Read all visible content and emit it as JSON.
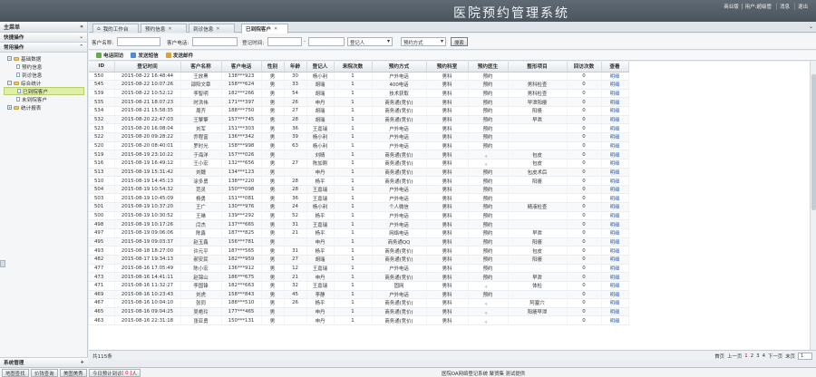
{
  "app": {
    "title": "医院预约管理系统",
    "top_links": [
      "商业版 | 用户名",
      "退出",
      "消息",
      "退出"
    ]
  },
  "topbar": {
    "links": [
      "商业版 │ 用户:超级管",
      "消息",
      "退出"
    ]
  },
  "left": {
    "main_menu": "主菜单",
    "quick_ops": "快捷操作",
    "common_ops": "常用操作",
    "tree": [
      {
        "label": "基础数据",
        "level": 0
      },
      {
        "label": "预约信息",
        "level": 1
      },
      {
        "label": "到诊信息",
        "level": 1
      },
      {
        "label": "综合统计",
        "level": 0
      },
      {
        "label": "已到院客户",
        "level": 1,
        "selected": true
      },
      {
        "label": "未到院客户",
        "level": 1
      },
      {
        "label": "统计报表",
        "level": 0
      }
    ],
    "system_mgmt": "系统管理"
  },
  "tabs": [
    {
      "label": "我的工作台"
    },
    {
      "label": "预约信息"
    },
    {
      "label": "到诊信息"
    },
    {
      "label": "已到院客户",
      "active": true
    }
  ],
  "search": {
    "name_label": "客户名称:",
    "phone_label": "客户电话:",
    "time_label": "登记时间:",
    "dash": "-",
    "registrar_select": "登记人",
    "method_select": "预约方式",
    "search_button": "搜索"
  },
  "toolbar": {
    "callback": "电话回访",
    "sms": "发送短信",
    "email": "发送邮件"
  },
  "table": {
    "headers": [
      "ID",
      "登记时间",
      "客户名称",
      "客户电话",
      "性别",
      "年龄",
      "登记人",
      "来院次数",
      "预约方式",
      "预约科室",
      "预约医生",
      "整形项目",
      "回访次数",
      "查看"
    ],
    "rows": [
      [
        "550",
        "2015-08-22 16:48:44",
        "王放黑",
        "138***923",
        "男",
        "30",
        "杨小利",
        "1",
        "户外电话",
        "男科",
        "预约",
        "",
        "0",
        "明细"
      ],
      [
        "545",
        "2015-08-22 10:07:26",
        "邵阳文章",
        "158***624",
        "男",
        "33",
        "胡瑞",
        "1",
        "400电话",
        "男科",
        "预约",
        "男科检查",
        "0",
        "明细"
      ],
      [
        "539",
        "2015-08-22 10:52:12",
        "李智明",
        "182***266",
        "男",
        "54",
        "胡瑞",
        "1",
        "技术获取",
        "男科",
        "预约",
        "男科检查",
        "0",
        "明细"
      ],
      [
        "535",
        "2015-08-21 18:07:23",
        "时洪伟",
        "171***397",
        "男",
        "26",
        "申丹",
        "1",
        "商务通(竞价)",
        "男科",
        "预约",
        "早泄阳痿",
        "0",
        "明细"
      ],
      [
        "534",
        "2015-08-21 15:58:35",
        "周齐",
        "188***750",
        "男",
        "27",
        "胡瑞",
        "1",
        "商务通(竞价)",
        "男科",
        "预约",
        "阳痿",
        "0",
        "明细"
      ],
      [
        "532",
        "2015-08-20 22:47:03",
        "王擎擎",
        "157***745",
        "男",
        "28",
        "胡瑞",
        "1",
        "商务通(竞价)",
        "男科",
        "预约",
        "早泄",
        "0",
        "明细"
      ],
      [
        "523",
        "2015-08-20 16:08:04",
        "刘军",
        "151***303",
        "男",
        "36",
        "王嘉瑞",
        "1",
        "户外电话",
        "男科",
        "预约",
        "",
        "0",
        "明细"
      ],
      [
        "522",
        "2015-08-20 09:28:22",
        "乔程富",
        "136***342",
        "男",
        "39",
        "杨小利",
        "1",
        "户外电话",
        "男科",
        "预约",
        "",
        "0",
        "明细"
      ],
      [
        "520",
        "2015-08-20 08:40:01",
        "罗时光",
        "158***998",
        "男",
        "63",
        "杨小利",
        "1",
        "户外电话",
        "男科",
        "预约",
        "",
        "0",
        "明细"
      ],
      [
        "519",
        "2015-08-19 23:10:22",
        "于海洋",
        "157***026",
        "男",
        "",
        "刘晴",
        "1",
        "商务通(竞价)",
        "男科",
        "。",
        "包皮",
        "0",
        "明细"
      ],
      [
        "516",
        "2015-08-19 16:49:12",
        "王小宏",
        "132***656",
        "男",
        "27",
        "陈加刚",
        "1",
        "商务通(竞价)",
        "男科",
        "。",
        "包皮",
        "0",
        "明细"
      ],
      [
        "513",
        "2015-08-19 15:31:42",
        "刘魏",
        "134***123",
        "男",
        "",
        "申丹",
        "1",
        "商务通(竞价)",
        "男科",
        "预约",
        "包皮术后",
        "0",
        "明细"
      ],
      [
        "510",
        "2015-08-19 14:45:13",
        "涂多勇",
        "138***220",
        "男",
        "28",
        "杨平",
        "1",
        "商务通(竞价)",
        "男科",
        "预约",
        "阳痿",
        "0",
        "明细"
      ],
      [
        "504",
        "2015-08-19 10:54:32",
        "范灵",
        "150***098",
        "男",
        "28",
        "王嘉瑞",
        "1",
        "户外电话",
        "男科",
        "预约",
        "",
        "0",
        "明细"
      ],
      [
        "503",
        "2015-08-19 10:45:09",
        "杨勇",
        "151***081",
        "男",
        "36",
        "王嘉瑞",
        "1",
        "户外电话",
        "男科",
        "预约",
        "",
        "0",
        "明细"
      ],
      [
        "501",
        "2015-08-19 10:37:20",
        "王广",
        "130***976",
        "男",
        "24",
        "杨小利",
        "1",
        "个人微信",
        "男科",
        "预约",
        "精液检查",
        "0",
        "明细"
      ],
      [
        "500",
        "2015-08-19 10:30:52",
        "王琳",
        "139***292",
        "男",
        "52",
        "杨平",
        "1",
        "户外电话",
        "男科",
        "预约",
        "",
        "0",
        "明细"
      ],
      [
        "498",
        "2015-08-19 10:17:26",
        "闫杰",
        "137***665",
        "男",
        "31",
        "王嘉瑞",
        "1",
        "户外电话",
        "男科",
        "预约",
        "",
        "0",
        "明细"
      ],
      [
        "497",
        "2015-08-19 09:06:06",
        "陈鑫",
        "187***825",
        "男",
        "21",
        "杨平",
        "1",
        "网络电话",
        "男科",
        "预约",
        "早泄",
        "0",
        "明细"
      ],
      [
        "495",
        "2015-08-19 09:03:37",
        "赵玉鑫",
        "156***781",
        "男",
        "",
        "申丹",
        "1",
        "商务通QQ",
        "男科",
        "预约",
        "阳痿",
        "0",
        "明细"
      ],
      [
        "493",
        "2015-08-18 18:27:00",
        "许元平",
        "187***565",
        "男",
        "31",
        "杨平",
        "1",
        "商务通(竞价)",
        "男科",
        "预约",
        "包皮",
        "0",
        "明细"
      ],
      [
        "482",
        "2015-08-17 19:34:13",
        "郝安民",
        "182***959",
        "男",
        "27",
        "胡瑞",
        "1",
        "商务通(竞价)",
        "男科",
        "预约",
        "阳痿",
        "0",
        "明细"
      ],
      [
        "477",
        "2015-08-16 17:05:49",
        "陈小宏",
        "136***912",
        "男",
        "12",
        "王嘉瑞",
        "1",
        "户外电话",
        "男科",
        "预约",
        "",
        "0",
        "明细"
      ],
      [
        "473",
        "2015-08-16 14:41:11",
        "赵锦山",
        "186***675",
        "男",
        "21",
        "申丹",
        "1",
        "商务通(竞价)",
        "男科",
        "预约",
        "早泄",
        "0",
        "明细"
      ],
      [
        "471",
        "2015-08-16 11:32:27",
        "李国锋",
        "182***663",
        "男",
        "32",
        "王嘉瑞",
        "1",
        "固网",
        "男科",
        "。",
        "体检",
        "0",
        "明细"
      ],
      [
        "469",
        "2015-08-16 10:23:43",
        "刘虎",
        "158***843",
        "男",
        "45",
        "李静",
        "1",
        "户外电话",
        "男科",
        "预约",
        "",
        "0",
        "明细"
      ],
      [
        "467",
        "2015-08-16 10:04:10",
        "张同",
        "188***510",
        "男",
        "26",
        "杨平",
        "1",
        "商务通(竞价)",
        "男科",
        "。",
        "阿塞穴",
        "0",
        "明细"
      ],
      [
        "465",
        "2015-08-16 09:04:25",
        "吴艳玲",
        "177***465",
        "男",
        "",
        "申丹",
        "1",
        "商务通(竞价)",
        "男科",
        "。",
        "阳痿早泄",
        "0",
        "明细"
      ],
      [
        "463",
        "2015-08-16 22:31:18",
        "张亚勇",
        "150***131",
        "男",
        "",
        "申丹",
        "1",
        "商务通(竞价)",
        "男科",
        "。",
        "",
        "0",
        "明细"
      ]
    ]
  },
  "pager": {
    "total": "共115条",
    "first": "首页",
    "prev": "上一页",
    "pages": [
      "1",
      "2",
      "3",
      "4"
    ],
    "next": "下一页",
    "last": "末页",
    "page_select": "1"
  },
  "statusbar": {
    "b1": "地图查找",
    "b2": "价钱查询",
    "b3": "美图美秀",
    "b4": "今日预计到诊",
    "count": "[ 0 ]",
    "unit": "人",
    "center": "医院OA网络登记系统 聚贸集 测试提供"
  },
  "colors": {
    "topbar": "#55606a",
    "accent_red": "#c8001e",
    "link": "#2a62b5",
    "selected_tree": "#dfeea8"
  }
}
